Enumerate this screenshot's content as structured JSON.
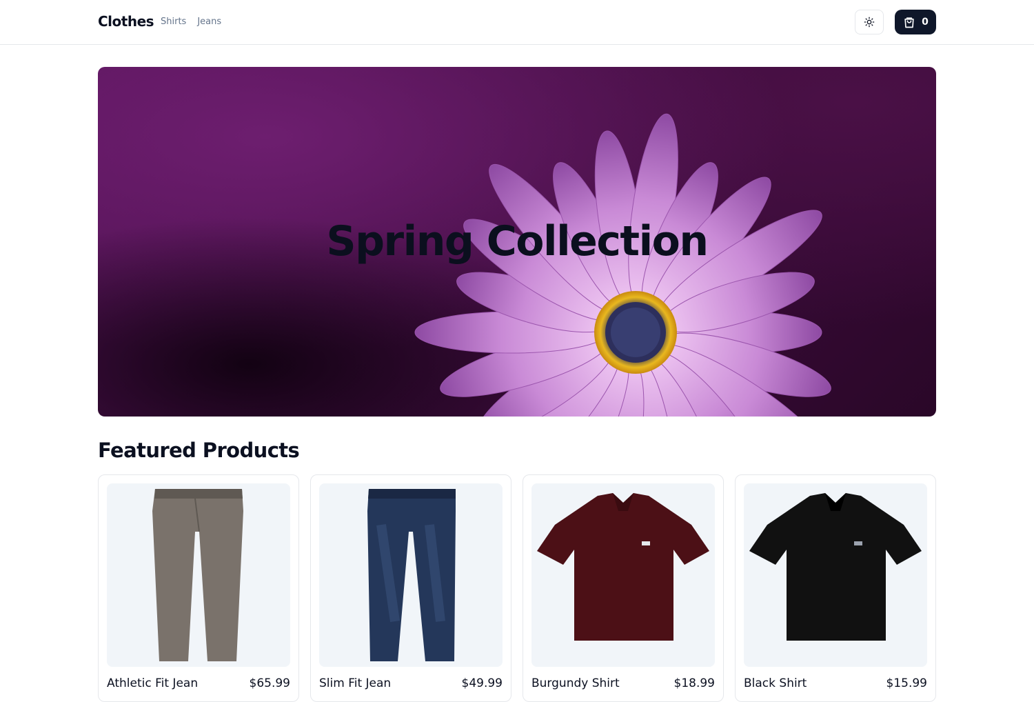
{
  "header": {
    "brand": "Clothes",
    "nav": [
      "Shirts",
      "Jeans"
    ],
    "theme_icon": "sun-icon",
    "cart_icon": "shopping-bag-icon",
    "cart_count": "0"
  },
  "hero": {
    "title": "Spring Collection",
    "image": "purple-daisy-flower"
  },
  "featured": {
    "title": "Featured Products",
    "products": [
      {
        "name": "Athletic Fit Jean",
        "price": "$65.99",
        "image": "gray-jeans"
      },
      {
        "name": "Slim Fit Jean",
        "price": "$49.99",
        "image": "blue-jeans"
      },
      {
        "name": "Burgundy Shirt",
        "price": "$18.99",
        "image": "burgundy-polo-shirt"
      },
      {
        "name": "Black Shirt",
        "price": "$15.99",
        "image": "black-polo-shirt"
      }
    ]
  },
  "colors": {
    "text": "#0b1020",
    "muted": "#64748b",
    "cart_bg": "#0f172a",
    "card_image_bg": "#f1f5f9",
    "hero_bg": "#4a1046",
    "petal": "#c98ad6"
  }
}
